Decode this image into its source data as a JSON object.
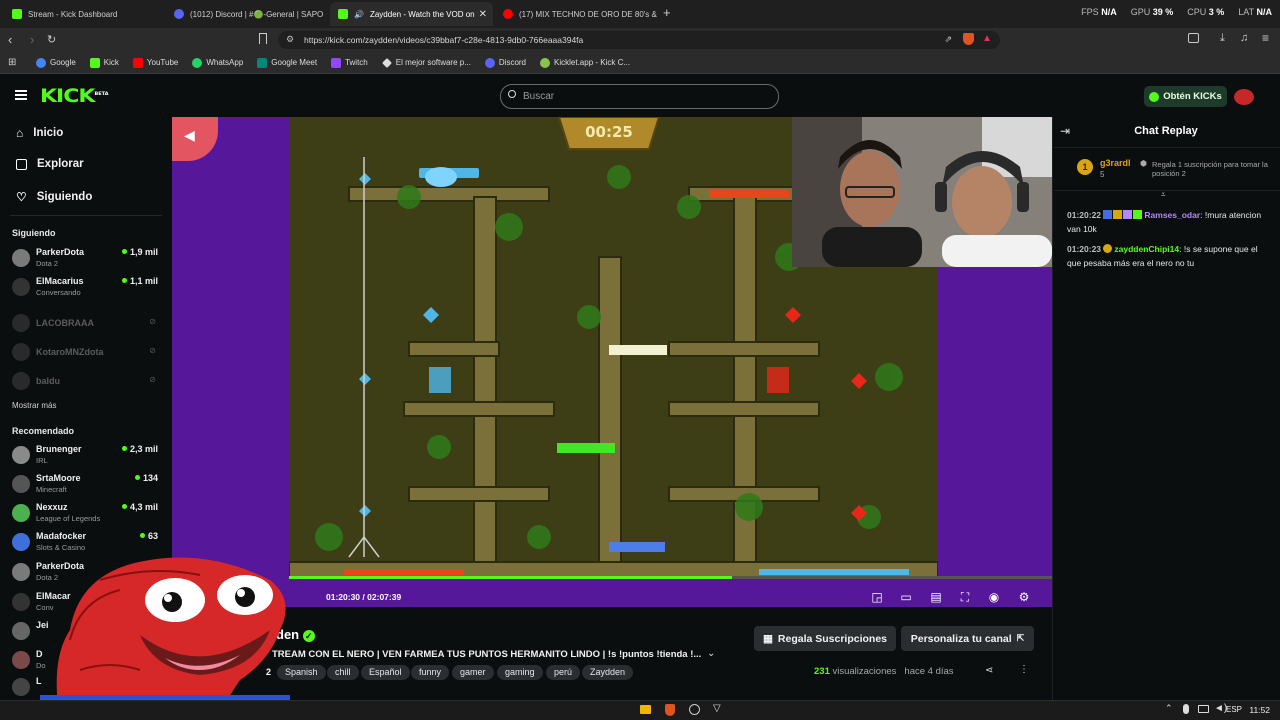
{
  "browser": {
    "tabs": [
      {
        "title": "Stream - Kick Dashboard",
        "icon": "kick-icon",
        "color": "#53fc18"
      },
      {
        "title": "(1012) Discord | #🟢-General | SAPO",
        "icon": "discord-icon",
        "color": "#5865f2"
      },
      {
        "title": "Zaydden - Watch the VOD on",
        "icon": "kick-icon",
        "color": "#53fc18",
        "active": true
      },
      {
        "title": "(17) MIX TECHNO DE ORO DE 80's &",
        "icon": "youtube-icon",
        "color": "#ff0000"
      }
    ],
    "perf": {
      "fps_label": "FPS",
      "fps": "N/A",
      "gpu_label": "GPU",
      "gpu": "39 %",
      "cpu_label": "CPU",
      "cpu": "3 %",
      "lat_label": "LAT",
      "lat": "N/A"
    },
    "url": "https://kick.com/zaydden/videos/c39bbaf7-c28e-4813-9db0-766eaaa394fa",
    "bookmarks": [
      "Google",
      "Kick",
      "YouTube",
      "WhatsApp",
      "Google Meet",
      "Twitch",
      "El mejor software p...",
      "Discord",
      "Kicklet.app - Kick C..."
    ]
  },
  "header": {
    "logo": "KICK",
    "logo_badge": "BETA",
    "search_placeholder": "Buscar",
    "kicks_button": "Obtén KICKs"
  },
  "sidebar": {
    "nav": [
      {
        "label": "Inicio",
        "icon": "home-icon"
      },
      {
        "label": "Explorar",
        "icon": "compass-icon"
      },
      {
        "label": "Siguiendo",
        "icon": "heart-icon"
      }
    ],
    "following_title": "Siguiendo",
    "following": [
      {
        "name": "ParkerDota",
        "category": "Dota 2",
        "viewers": "1,9 mil",
        "online": true
      },
      {
        "name": "ElMacarius",
        "category": "Conversando",
        "viewers": "1,1 mil",
        "online": true
      },
      {
        "name": "LACOBRAAA",
        "online": false
      },
      {
        "name": "KotaroMNZdota",
        "online": false
      },
      {
        "name": "baldu",
        "online": false
      }
    ],
    "show_more": "Mostrar más",
    "recommended_title": "Recomendado",
    "recommended": [
      {
        "name": "Brunenger",
        "category": "IRL",
        "viewers": "2,3 mil"
      },
      {
        "name": "SrtaMoore",
        "category": "Minecraft",
        "viewers": "134"
      },
      {
        "name": "Nexxuz",
        "category": "League of Legends",
        "viewers": "4,3 mil"
      },
      {
        "name": "Madafocker",
        "category": "Slots & Casino",
        "viewers": "63"
      },
      {
        "name": "ParkerDota",
        "category": "Dota 2",
        "viewers": ""
      },
      {
        "name": "ElMacar",
        "category": "Conv",
        "viewers": ""
      },
      {
        "name": "Jei",
        "category": "",
        "viewers": ""
      },
      {
        "name": "D",
        "category": "Do",
        "viewers": ""
      },
      {
        "name": "L",
        "category": "",
        "viewers": ""
      }
    ]
  },
  "player": {
    "game_timer": "00:25",
    "time_current": "01:20:30",
    "time_sep": "/",
    "time_total": "02:07:39",
    "progress": 0.58
  },
  "video": {
    "streamer_partial": "den",
    "title": "TREAM CON EL NERO |  VEN FARMEA TUS PUNTOS HERMANITO LINDO | !s !puntos !tienda !...",
    "tags": [
      "Spanish",
      "chill",
      "Español",
      "funny",
      "gamer",
      "gaming",
      "perú",
      "Zaydden"
    ],
    "tag_count_prefix": "2",
    "subs_button": "Regala Suscripciones",
    "customize_button": "Personaliza tu canal",
    "views_count": "231",
    "views_label": "visualizaciones",
    "age": "hace 4 días"
  },
  "chat": {
    "title": "Chat Replay",
    "top_gifter": {
      "rank": "1",
      "name": "g3rardl",
      "count": "5",
      "promo": "Regala 1 suscripción para tomar la posición 2"
    },
    "messages": [
      {
        "time": "01:20:22",
        "user": "Ramses_odar",
        "user_color": "#b388ff",
        "text": "!mura atencion van 10k"
      },
      {
        "time": "01:20:23",
        "user": "zayddenChipi14",
        "user_color": "#53fc18",
        "text": "!s se supone que el que pesaba más era el nero no tu"
      }
    ]
  },
  "taskbar": {
    "lang": "ESP",
    "clock": "11:52"
  }
}
